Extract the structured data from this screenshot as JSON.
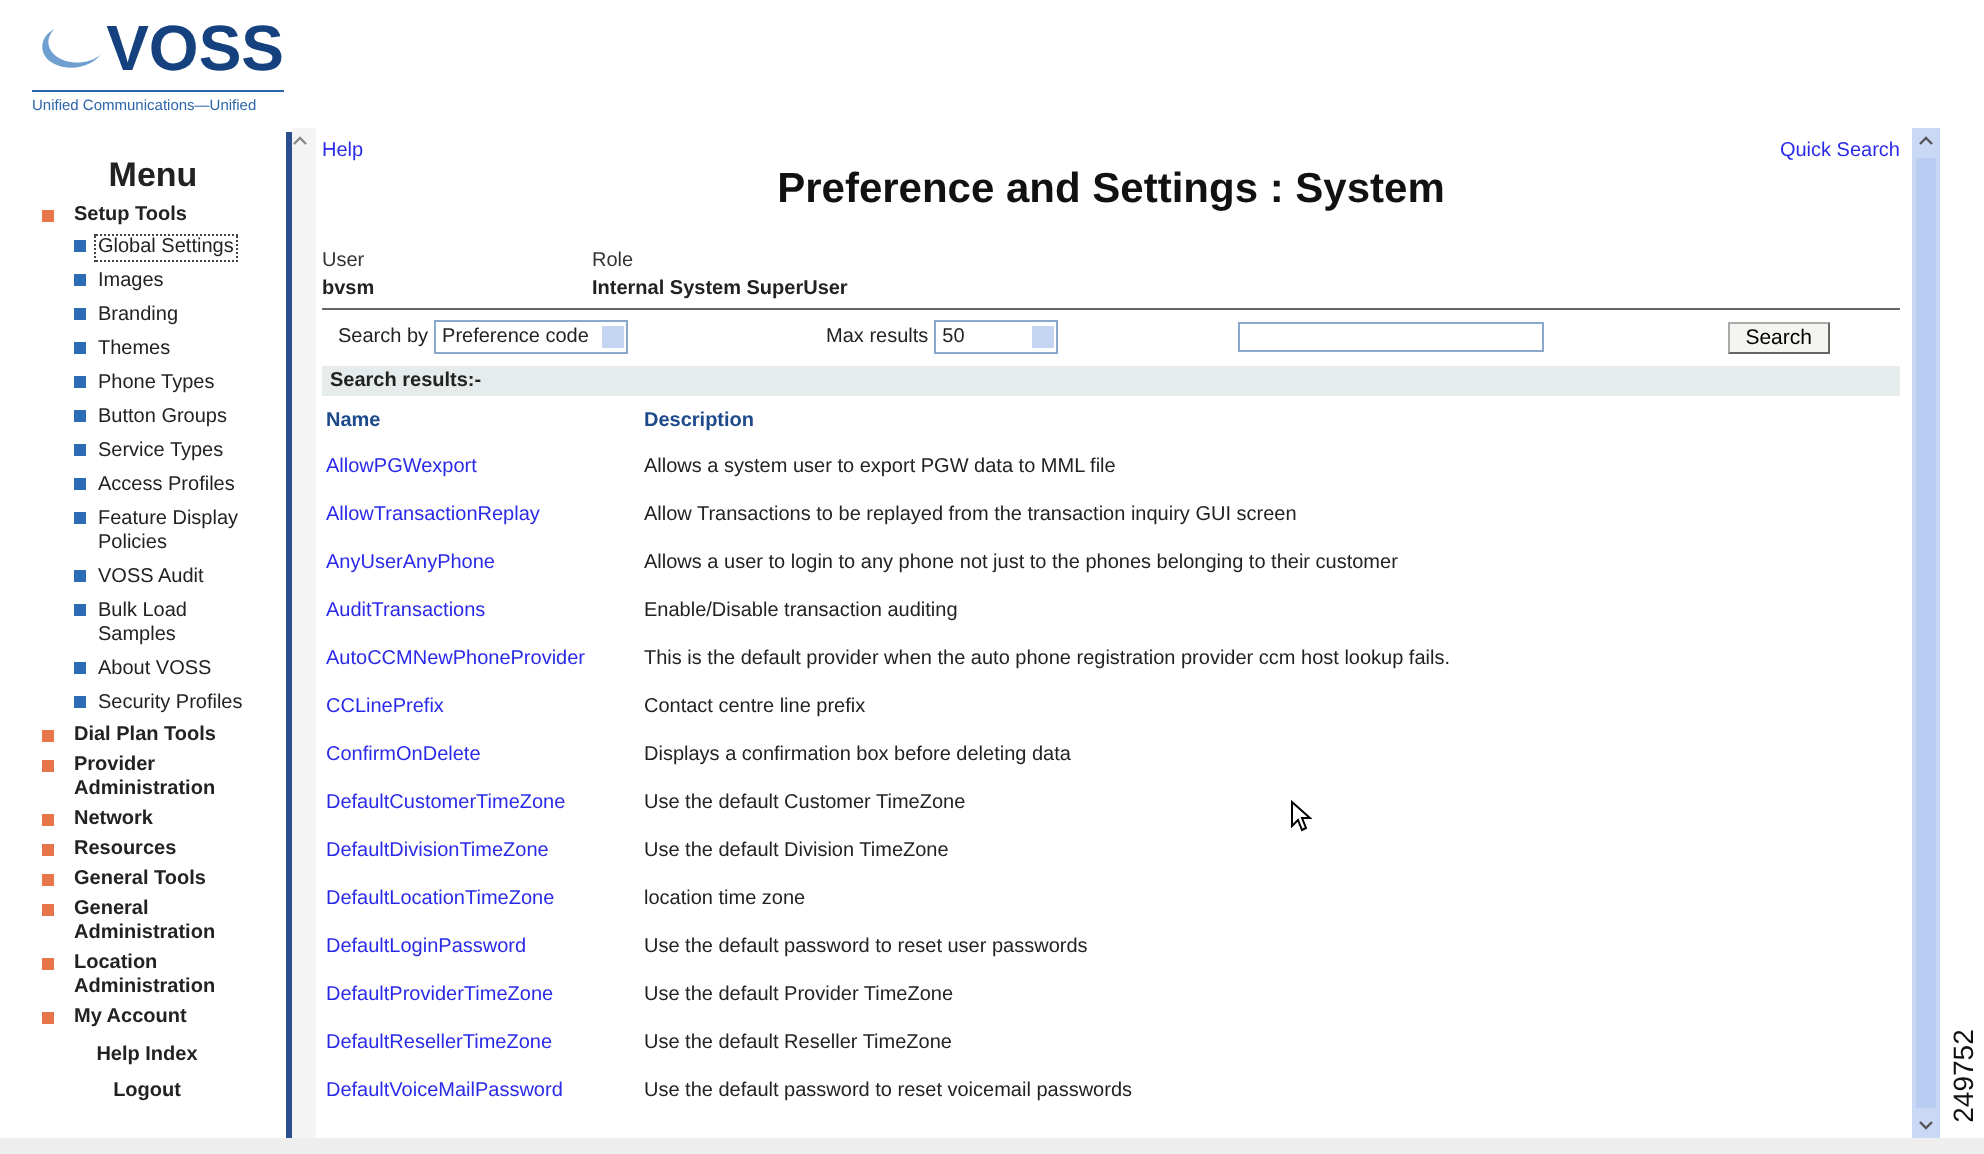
{
  "logo": {
    "wordmark": "VOSS",
    "tagline": "Unified Communications—Unified"
  },
  "menu": {
    "title": "Menu",
    "items": [
      {
        "kind": "section",
        "label": "Setup Tools",
        "children": [
          {
            "label": "Global Settings",
            "selected": true
          },
          {
            "label": "Images",
            "selected": false
          },
          {
            "label": "Branding",
            "selected": false
          },
          {
            "label": "Themes",
            "selected": false
          },
          {
            "label": "Phone Types",
            "selected": false
          },
          {
            "label": "Button Groups",
            "selected": false
          },
          {
            "label": "Service Types",
            "selected": false
          },
          {
            "label": "Access Profiles",
            "selected": false
          },
          {
            "label": "Feature Display Policies",
            "selected": false
          },
          {
            "label": "VOSS Audit",
            "selected": false
          },
          {
            "label": "Bulk Load Samples",
            "selected": false
          },
          {
            "label": "About VOSS",
            "selected": false
          },
          {
            "label": "Security Profiles",
            "selected": false
          }
        ]
      },
      {
        "kind": "section",
        "label": "Dial Plan Tools"
      },
      {
        "kind": "section",
        "label": "Provider Administration"
      },
      {
        "kind": "section",
        "label": "Network"
      },
      {
        "kind": "section",
        "label": "Resources"
      },
      {
        "kind": "section",
        "label": "General Tools"
      },
      {
        "kind": "section",
        "label": "General Administration"
      },
      {
        "kind": "section",
        "label": "Location Administration"
      },
      {
        "kind": "section",
        "label": "My Account"
      },
      {
        "kind": "link",
        "label": "Help Index"
      },
      {
        "kind": "link",
        "label": "Logout"
      }
    ]
  },
  "main": {
    "help_link": "Help",
    "quick_search_link": "Quick Search",
    "title": "Preference and Settings : System",
    "user": {
      "label": "User",
      "value": "bvsm"
    },
    "role": {
      "label": "Role",
      "value": "Internal System SuperUser"
    },
    "search_by": {
      "label": "Search by",
      "value": "Preference code"
    },
    "max_results": {
      "label": "Max results",
      "value": "50"
    },
    "search_button": "Search",
    "results_heading": "Search results:-",
    "table": {
      "columns": [
        "Name",
        "Description"
      ],
      "rows": [
        [
          "AllowPGWexport",
          "Allows a system user to export PGW data to MML file"
        ],
        [
          "AllowTransactionReplay",
          "Allow Transactions to be replayed from the transaction inquiry GUI screen"
        ],
        [
          "AnyUserAnyPhone",
          "Allows a user to login to any phone not just to the phones belonging to their customer"
        ],
        [
          "AuditTransactions",
          "Enable/Disable transaction auditing"
        ],
        [
          "AutoCCMNewPhoneProvider",
          "This is the default provider when the auto phone registration provider ccm host lookup fails."
        ],
        [
          "CCLinePrefix",
          "Contact centre line prefix"
        ],
        [
          "ConfirmOnDelete",
          "Displays a confirmation box before deleting data"
        ],
        [
          "DefaultCustomerTimeZone",
          "Use the default Customer TimeZone"
        ],
        [
          "DefaultDivisionTimeZone",
          "Use the default Division TimeZone"
        ],
        [
          "DefaultLocationTimeZone",
          "location time zone"
        ],
        [
          "DefaultLoginPassword",
          "Use the default password to reset user passwords"
        ],
        [
          "DefaultProviderTimeZone",
          "Use the default Provider TimeZone"
        ],
        [
          "DefaultResellerTimeZone",
          "Use the default Reseller TimeZone"
        ],
        [
          "DefaultVoiceMailPassword",
          "Use the default password to reset voicemail passwords"
        ]
      ]
    }
  },
  "figure_number": "249752"
}
